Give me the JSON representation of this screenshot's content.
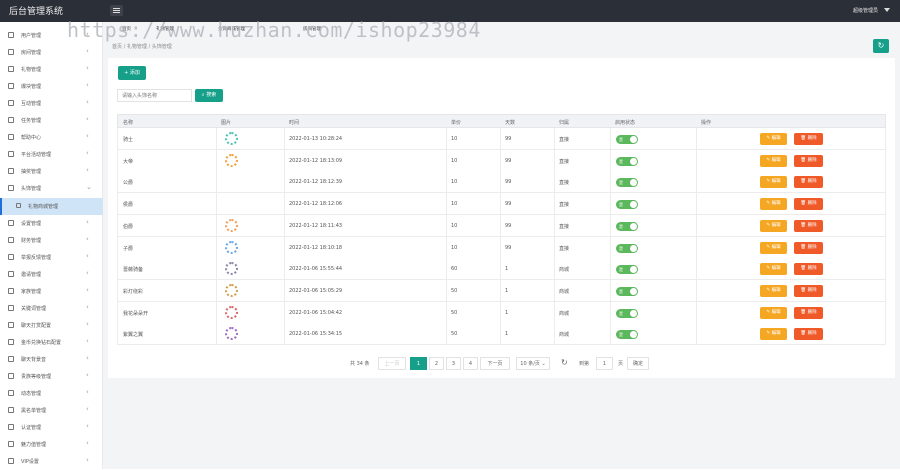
{
  "header": {
    "brand": "后台管理系统",
    "user": "超级管理员",
    "tabs": [
      "首页",
      "礼物管理",
      "头饰商城管理",
      "房间管理"
    ]
  },
  "watermark": "https://www.huzhan.com/ishop23984",
  "sidebar": {
    "items": [
      {
        "label": "用户管理",
        "chevron": "‹"
      },
      {
        "label": "房间管理",
        "chevron": "‹"
      },
      {
        "label": "礼物管理",
        "chevron": "‹"
      },
      {
        "label": "爆块管理",
        "chevron": "‹"
      },
      {
        "label": "互动管理",
        "chevron": "‹"
      },
      {
        "label": "任务管理",
        "chevron": "‹"
      },
      {
        "label": "帮助中心",
        "chevron": "‹"
      },
      {
        "label": "平台活动管理",
        "chevron": "‹"
      },
      {
        "label": "抽奖管理",
        "chevron": "‹"
      },
      {
        "label": "头饰管理",
        "chevron": "⌄"
      },
      {
        "label": "礼物商城管理",
        "chevron": ""
      },
      {
        "label": "设置管理",
        "chevron": "‹"
      },
      {
        "label": "财务管理",
        "chevron": "‹"
      },
      {
        "label": "举报反馈管理",
        "chevron": "‹"
      },
      {
        "label": "邀请管理",
        "chevron": "‹"
      },
      {
        "label": "家族管理",
        "chevron": "‹"
      },
      {
        "label": "关键词管理",
        "chevron": "‹"
      },
      {
        "label": "聊天打赏配置",
        "chevron": "‹"
      },
      {
        "label": "金币兑换钻石配置",
        "chevron": "‹"
      },
      {
        "label": "聊天背景音",
        "chevron": "‹"
      },
      {
        "label": "贵族等级管理",
        "chevron": "‹"
      },
      {
        "label": "动态管理",
        "chevron": "‹"
      },
      {
        "label": "黑名单管理",
        "chevron": "‹"
      },
      {
        "label": "认证管理",
        "chevron": "‹"
      },
      {
        "label": "魅力值管理",
        "chevron": "‹"
      },
      {
        "label": "VIP设置",
        "chevron": "‹"
      }
    ]
  },
  "breadcrumb": [
    "首页",
    "礼物管理",
    "头饰管理"
  ],
  "toolbar": {
    "add_label": "+ 添加",
    "search_placeholder": "请输入头饰名称",
    "search_label": "搜索"
  },
  "table": {
    "headers": [
      "名称",
      "图片",
      "时间",
      "单价",
      "天数",
      "归属",
      "启用状态",
      "操作"
    ],
    "rows": [
      {
        "name": "骑士",
        "has_image": true,
        "ring_color": "#4fc3b5",
        "time": "2022-01-13 10:28:24",
        "price": "10",
        "days": "99",
        "owner": "直接"
      },
      {
        "name": "大帝",
        "has_image": true,
        "ring_color": "#f0a040",
        "time": "2022-01-12 18:13:09",
        "price": "10",
        "days": "99",
        "owner": "直接"
      },
      {
        "name": "公爵",
        "has_image": false,
        "ring_color": "",
        "time": "2022-01-12 18:12:39",
        "price": "10",
        "days": "99",
        "owner": "直接"
      },
      {
        "name": "侯爵",
        "has_image": false,
        "ring_color": "",
        "time": "2022-01-12 18:12:06",
        "price": "10",
        "days": "99",
        "owner": "直接"
      },
      {
        "name": "伯爵",
        "has_image": true,
        "ring_color": "#f0a060",
        "time": "2022-01-12 18:11:43",
        "price": "10",
        "days": "99",
        "owner": "直接"
      },
      {
        "name": "子爵",
        "has_image": true,
        "ring_color": "#6aa8e8",
        "time": "2022-01-12 18:10:18",
        "price": "10",
        "days": "99",
        "owner": "直接"
      },
      {
        "name": "薔薇骑备",
        "has_image": true,
        "ring_color": "#8a8aa8",
        "time": "2022-01-06 15:55:44",
        "price": "60",
        "days": "1",
        "owner": "商城"
      },
      {
        "name": "彩灯绕彩",
        "has_image": true,
        "ring_color": "#d0a050",
        "time": "2022-01-06 15:05:29",
        "price": "50",
        "days": "1",
        "owner": "商城"
      },
      {
        "name": "我花朵朵开",
        "has_image": true,
        "ring_color": "#d86a6a",
        "time": "2022-01-06 15:04:42",
        "price": "50",
        "days": "1",
        "owner": "商城"
      },
      {
        "name": "紫翼之翼",
        "has_image": true,
        "ring_color": "#a070c0",
        "time": "2022-01-06 15:34:15",
        "price": "50",
        "days": "1",
        "owner": "商城"
      }
    ],
    "switch_label": "是",
    "edit_label": "✎ 编辑",
    "delete_label": "🗑 删除"
  },
  "pagination": {
    "total": "共 34 条",
    "prev": "上一页",
    "pages": [
      "1",
      "2",
      "3",
      "4"
    ],
    "current": "1",
    "next": "下一页",
    "page_size": "10 条/页",
    "goto_prefix": "到第",
    "goto_value": "1",
    "goto_suffix": "页",
    "confirm": "确定"
  }
}
